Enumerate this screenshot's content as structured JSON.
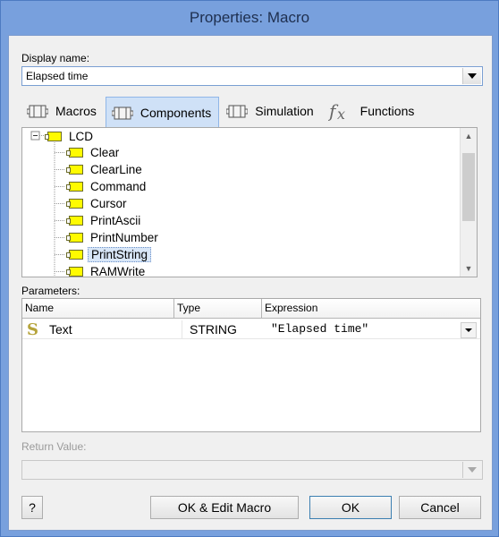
{
  "window": {
    "title": "Properties: Macro"
  },
  "display_name": {
    "label": "Display name:",
    "value": "Elapsed time"
  },
  "tabs": [
    {
      "label": "Macros",
      "icon": "macro-icon"
    },
    {
      "label": "Components",
      "icon": "component-icon",
      "active": true
    },
    {
      "label": "Simulation",
      "icon": "simulation-icon"
    },
    {
      "label": "Functions",
      "icon": "fx-icon"
    }
  ],
  "tree": {
    "root": "LCD",
    "items": [
      "Clear",
      "ClearLine",
      "Command",
      "Cursor",
      "PrintAscii",
      "PrintNumber",
      "PrintString",
      "RAMWrite"
    ],
    "selected": "PrintString"
  },
  "parameters": {
    "label": "Parameters:",
    "columns": [
      "Name",
      "Type",
      "Expression"
    ],
    "rows": [
      {
        "name": "Text",
        "type": "STRING",
        "expression": "\"Elapsed time\""
      }
    ]
  },
  "return_value": {
    "label": "Return Value:",
    "value": ""
  },
  "buttons": {
    "help": "?",
    "ok_edit": "OK & Edit Macro",
    "ok": "OK",
    "cancel": "Cancel"
  }
}
